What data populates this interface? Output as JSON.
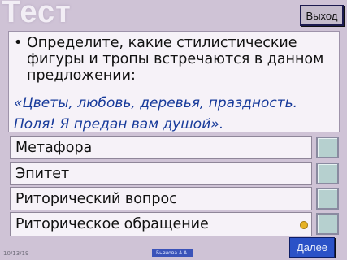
{
  "slide": {
    "title": "Тест",
    "exit_label": "Выход",
    "next_label": "Далее",
    "date": "10/13/19",
    "author": "Бьянова А.А."
  },
  "question": {
    "bullet": "•",
    "text": "Определите, какие стилистические фигуры и тропы встречаются в данном предложении:",
    "quote_line1": "«Цветы, любовь, деревья, праздность.",
    "quote_line2": "Поля! Я предан вам душой»."
  },
  "options": [
    {
      "label": "Метафора"
    },
    {
      "label": "Эпитет"
    },
    {
      "label": "Риторический вопрос"
    },
    {
      "label": "Риторическое обращение"
    }
  ],
  "colors": {
    "background": "#cfc3d6",
    "button": "#2b52c7",
    "quote": "#173a9a",
    "checkbox": "#b6d0cf",
    "dot": "#e6b226"
  }
}
